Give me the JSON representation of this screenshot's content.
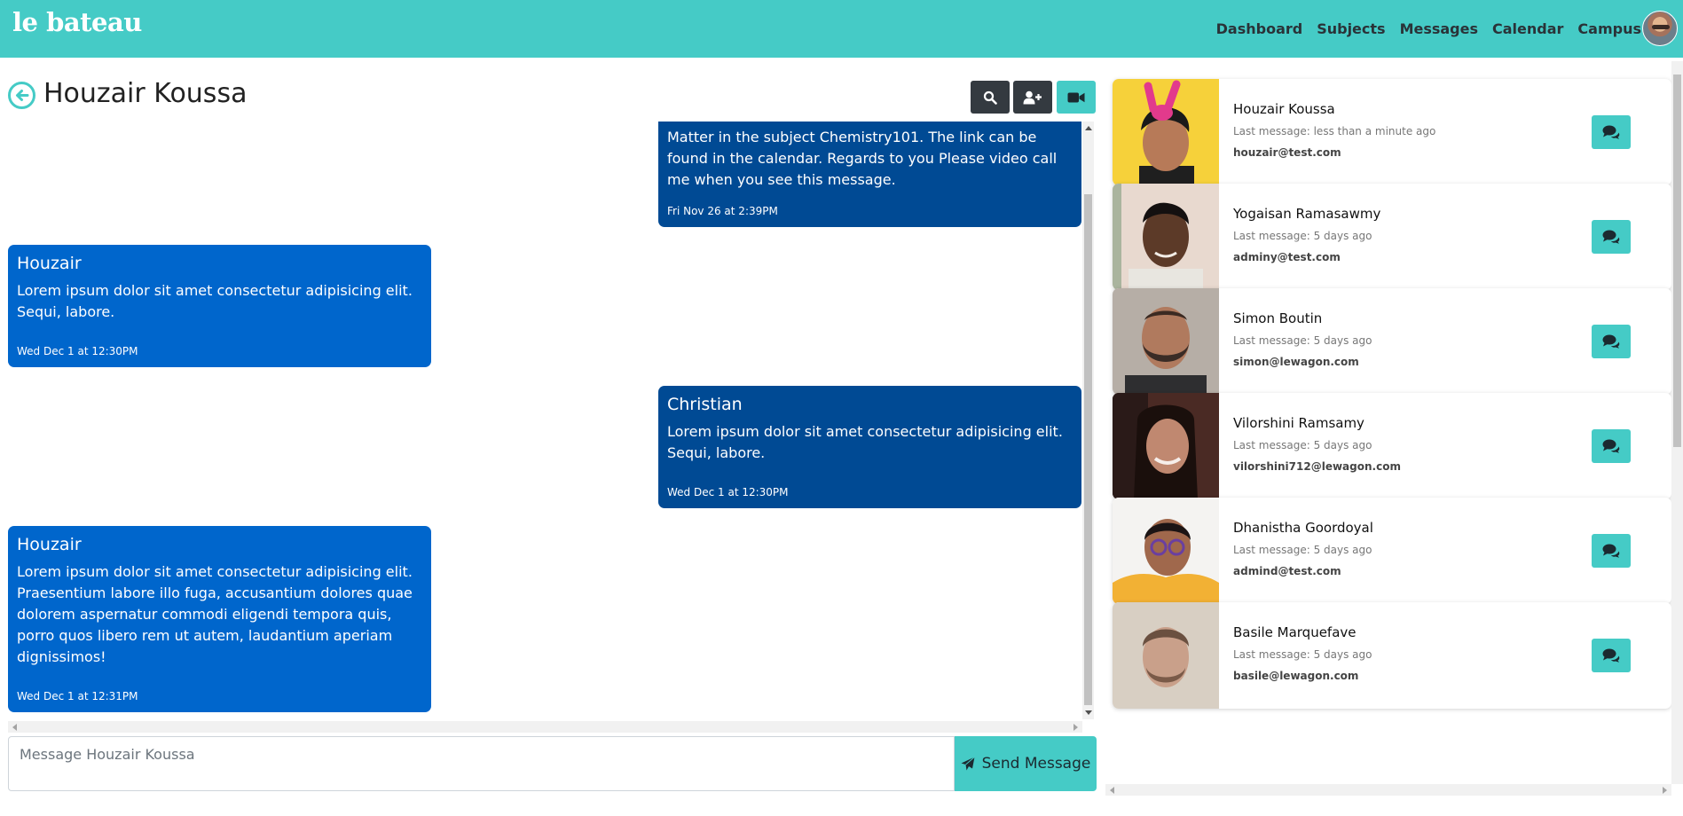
{
  "brand": "le bateau",
  "nav": {
    "links": [
      "Dashboard",
      "Subjects",
      "Messages",
      "Calendar",
      "Campus"
    ]
  },
  "chat": {
    "title": "Houzair Koussa",
    "messages": [
      {
        "direction": "out",
        "name": "",
        "text": "Matter in the subject Chemistry101. The link can be found in the calendar. Regards to you Please video call me when you see this message.",
        "time": "Fri Nov 26 at 2:39PM"
      },
      {
        "direction": "in",
        "name": "Houzair",
        "text": "Lorem ipsum dolor sit amet consectetur adipisicing elit. Sequi, labore.",
        "time": "Wed Dec 1 at 12:30PM"
      },
      {
        "direction": "out",
        "name": "Christian",
        "text": "Lorem ipsum dolor sit amet consectetur adipisicing elit. Sequi, labore.",
        "time": "Wed Dec 1 at 12:30PM"
      },
      {
        "direction": "in",
        "name": "Houzair",
        "text": "Lorem ipsum dolor sit amet consectetur adipisicing elit. Praesentium labore illo fuga, accusantium dolores quae dolorem aspernatur commodi eligendi tempora quis, porro quos libero rem ut autem, laudantium aperiam dignissimos!",
        "time": "Wed Dec 1 at 12:31PM"
      }
    ],
    "input_placeholder": "Message Houzair Koussa",
    "send_label": "Send Message"
  },
  "contacts": [
    {
      "name": "Houzair Koussa",
      "last": "Last message: less than a minute ago",
      "email": "houzair@test.com"
    },
    {
      "name": "Yogaisan Ramasawmy",
      "last": "Last message: 5 days ago",
      "email": "adminy@test.com"
    },
    {
      "name": "Simon Boutin",
      "last": "Last message: 5 days ago",
      "email": "simon@lewagon.com"
    },
    {
      "name": "Vilorshini Ramsamy",
      "last": "Last message: 5 days ago",
      "email": "vilorshini712@lewagon.com"
    },
    {
      "name": "Dhanistha Goordoyal",
      "last": "Last message: 5 days ago",
      "email": "admind@test.com"
    },
    {
      "name": "Basile Marquefave",
      "last": "Last message: 5 days ago",
      "email": "basile@lewagon.com"
    }
  ],
  "colors": {
    "accent": "#45cbc6",
    "incoming_bubble": "#0066cc",
    "outgoing_bubble": "#004a94",
    "dark_button": "#343a40"
  }
}
